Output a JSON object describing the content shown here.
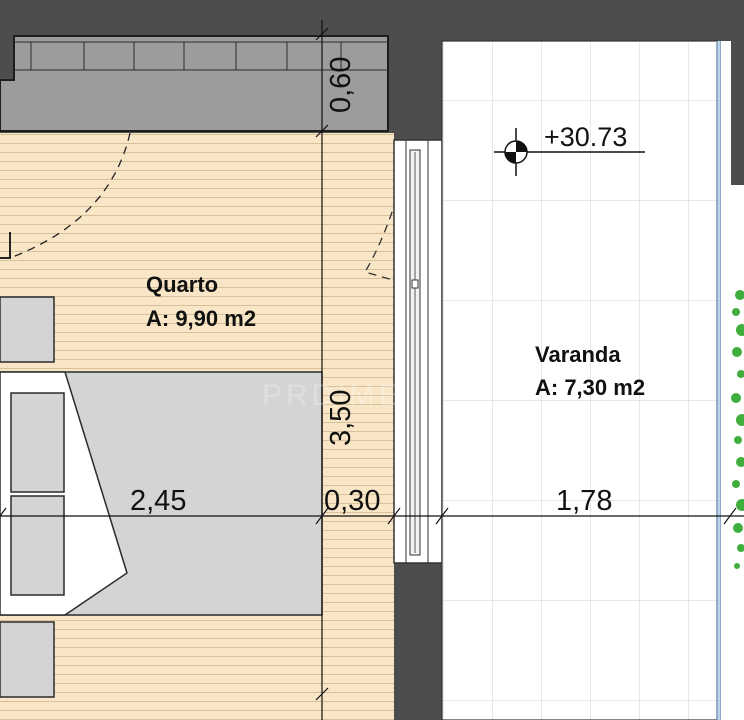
{
  "rooms": {
    "quarto": {
      "name": "Quarto",
      "area": "A: 9,90 m2"
    },
    "varanda": {
      "name": "Varanda",
      "area": "A: 7,30 m2"
    }
  },
  "dimensions": {
    "bedroom_width": "2,45",
    "wall_thickness": "0,30",
    "balcony_width": "1,78",
    "room_depth": "3,50",
    "wardrobe_depth": "0,60"
  },
  "level_mark": "+30.73",
  "watermark": "PRDIME",
  "colors": {
    "wall": "#4d4d4d",
    "wood_floor": "#f8e6c7",
    "wood_line": "#d7c09b",
    "tile_floor": "#ffffff",
    "tile_grid": "#d9d9d9",
    "furniture": "#d4d4d4",
    "wardrobe": "#9c9c9c",
    "glass": "#bcd4ec",
    "plant": "#3fae3c"
  }
}
